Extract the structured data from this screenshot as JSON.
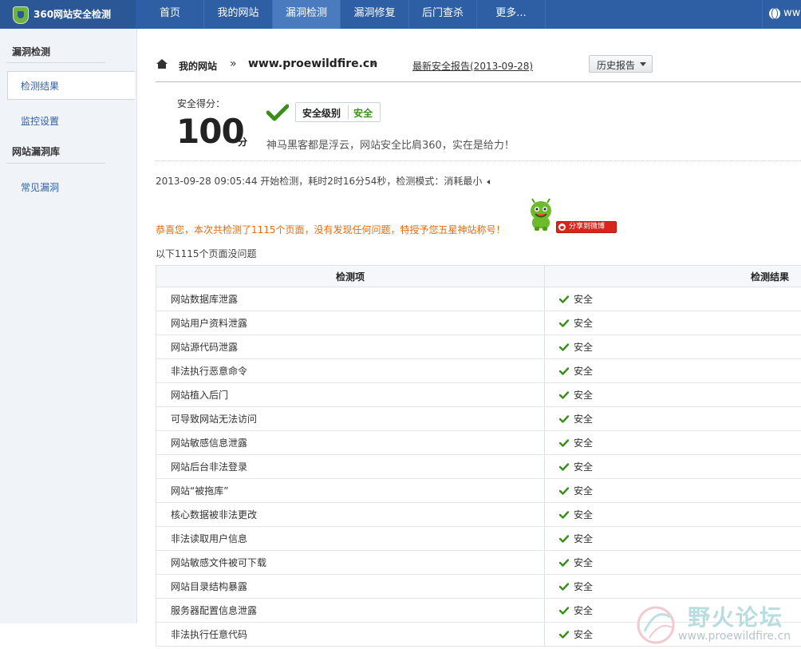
{
  "brand": {
    "title": "360网站安全检测"
  },
  "nav": {
    "items": [
      "首页",
      "我的网站",
      "漏洞检测",
      "漏洞修复",
      "后门查杀",
      "更多..."
    ],
    "active_index": 2,
    "right_label": "ww"
  },
  "sidebar": {
    "group1_title": "漏洞检测",
    "item_results": "检测结果",
    "item_monitor": "监控设置",
    "group2_title": "网站漏洞库",
    "item_common": "常见漏洞"
  },
  "breadcrumb": {
    "my_sites": "我的网站",
    "sep": "»",
    "domain": "www.proewildfire.cn",
    "latest_report": "最新安全报告(2013-09-28)",
    "history_button": "历史报告"
  },
  "score": {
    "label": "安全得分：",
    "value": "100",
    "unit": "分",
    "level_label": "安全级别",
    "level_value": "安全",
    "motto": "神马黑客都是浮云，网站安全比肩360，实在是给力！"
  },
  "scan_info": "2013-09-28 09:05:44 开始检测，耗时2时16分54秒，检测模式：消耗最小",
  "congrats": "恭喜您，本次共检测了1115个页面，没有发现任何问题，特授予您五星神站称号！",
  "share_button": "分享到微博",
  "pages_ok": "以下1115个页面没问题",
  "table": {
    "headers": [
      "检测项",
      "检测结果"
    ],
    "rows": [
      {
        "item": "网站数据库泄露",
        "result": "安全"
      },
      {
        "item": "网站用户资料泄露",
        "result": "安全"
      },
      {
        "item": "网站源代码泄露",
        "result": "安全"
      },
      {
        "item": "非法执行恶意命令",
        "result": "安全"
      },
      {
        "item": "网站植入后门",
        "result": "安全"
      },
      {
        "item": "可导致网站无法访问",
        "result": "安全"
      },
      {
        "item": "网站敏感信息泄露",
        "result": "安全"
      },
      {
        "item": "网站后台非法登录",
        "result": "安全"
      },
      {
        "item": "网站“被拖库”",
        "result": "安全"
      },
      {
        "item": "核心数据被非法更改",
        "result": "安全"
      },
      {
        "item": "非法读取用户信息",
        "result": "安全"
      },
      {
        "item": "网站敏感文件被可下载",
        "result": "安全"
      },
      {
        "item": "网站目录结构暴露",
        "result": "安全"
      },
      {
        "item": "服务器配置信息泄露",
        "result": "安全"
      },
      {
        "item": "非法执行任意代码",
        "result": "安全"
      }
    ]
  },
  "watermark": {
    "text": "野火论坛",
    "url": "www.proewildfire.cn"
  },
  "colors": {
    "nav_bg": "#2e5fa5",
    "safe_green": "#3a8f1a",
    "congrats_orange": "#e66a0c",
    "link_blue": "#2e5fa5"
  },
  "icons": [
    "shield-icon",
    "globe-icon",
    "home-icon",
    "check-icon",
    "chevron-down-icon",
    "weibo-icon",
    "mascot-icon"
  ]
}
